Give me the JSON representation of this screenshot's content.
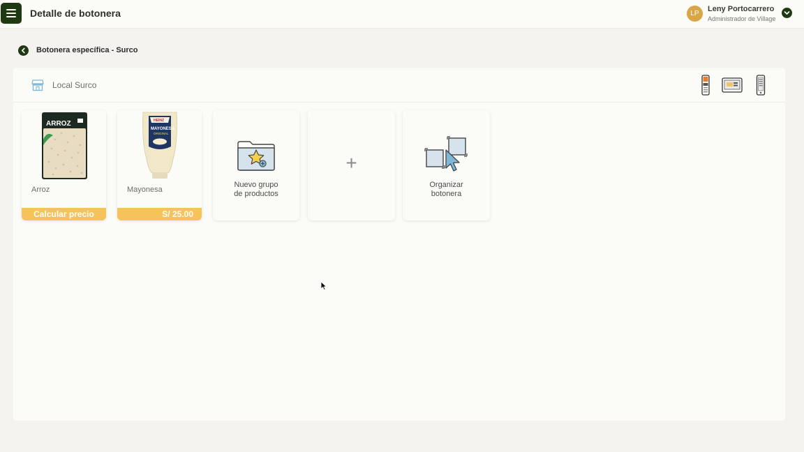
{
  "header": {
    "title": "Detalle de botonera",
    "user": {
      "initials": "LP",
      "name": "Leny Portocarrero",
      "role": "Administrador de Village"
    }
  },
  "breadcrumb": {
    "label": "Botonera específica - Surco"
  },
  "store": {
    "name": "Local Surco"
  },
  "products": [
    {
      "name": "Arroz",
      "action": "Calcular precio"
    },
    {
      "name": "Mayonesa",
      "price": "S/ 25.00"
    }
  ],
  "actions": {
    "new_group_line1": "Nuevo grupo",
    "new_group_line2": "de productos",
    "add_symbol": "+",
    "organize_line1": "Organizar",
    "organize_line2": "botonera"
  },
  "icons": {
    "menu": "hamburger-menu-icon",
    "store": "store-icon",
    "back": "chevron-left-icon",
    "user_dropdown": "chevron-down-icon",
    "devices": [
      "pos-terminal-icon",
      "card-reader-icon",
      "smartphone-icon"
    ]
  },
  "colors": {
    "brand_dark": "#1f3a12",
    "accent": "#f6c25c",
    "avatar": "#d9a546"
  }
}
